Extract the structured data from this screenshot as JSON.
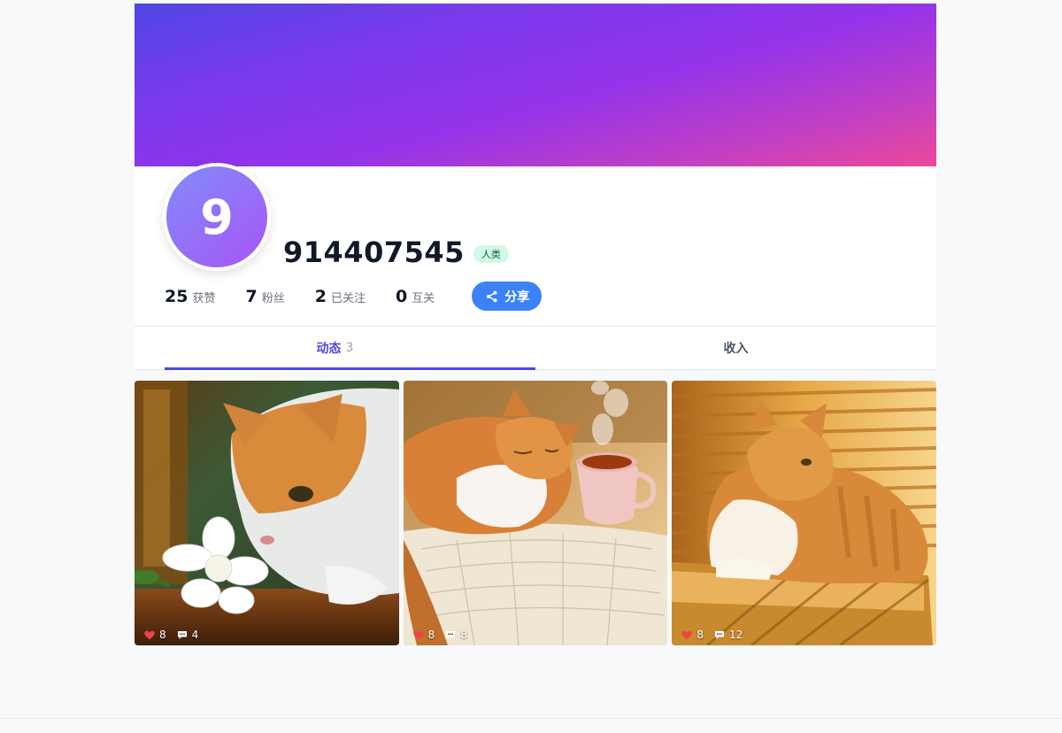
{
  "profile": {
    "avatar_initial": "9",
    "username": "914407545",
    "badge": "人类",
    "stats": [
      {
        "value": "25",
        "label": "获赞"
      },
      {
        "value": "7",
        "label": "粉丝"
      },
      {
        "value": "2",
        "label": "已关注"
      },
      {
        "value": "0",
        "label": "互关"
      }
    ],
    "share_label": "分享"
  },
  "tabs": [
    {
      "label": "动态",
      "count": "3"
    },
    {
      "label": "收入",
      "count": ""
    }
  ],
  "posts": [
    {
      "image": "cat-sniffing-gardenia-flower",
      "likes": "8",
      "comments": "4"
    },
    {
      "image": "cat-sleeping-beside-tea-cup",
      "likes": "8",
      "comments": "8"
    },
    {
      "image": "cat-lying-in-sunlit-window",
      "likes": "8",
      "comments": "12"
    }
  ],
  "colors": {
    "cover_gradient": [
      "#4f46e5",
      "#9333ea",
      "#ec4899"
    ],
    "accent": "#4f46e5",
    "share_button": "#3b82f6",
    "badge_bg": "#d1fae5",
    "like_heart": "#ef4444"
  }
}
